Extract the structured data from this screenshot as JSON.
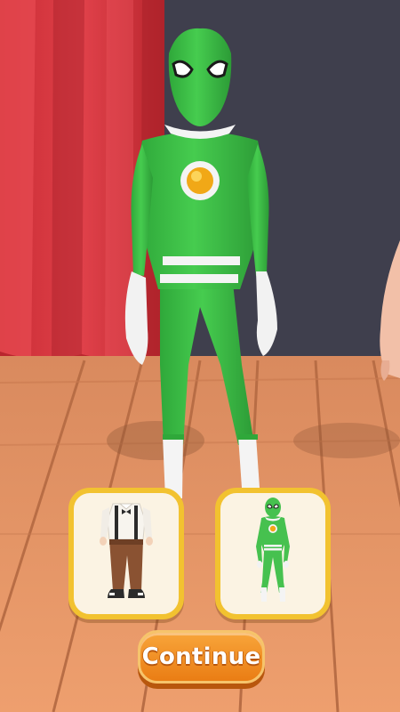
{
  "continue_button": {
    "label": "Continue"
  },
  "choices": [
    {
      "id": "outfit-vintage",
      "icon": "suspender-outfit-icon"
    },
    {
      "id": "outfit-green-hero",
      "icon": "green-hero-suit-icon"
    }
  ],
  "colors": {
    "curtain": "#d8333b",
    "backwall": "#3f3f4d",
    "floor": "#e39a6b",
    "suit_green": "#3fc548",
    "card_border": "#f2c230",
    "button_orange": "#f08a22"
  }
}
